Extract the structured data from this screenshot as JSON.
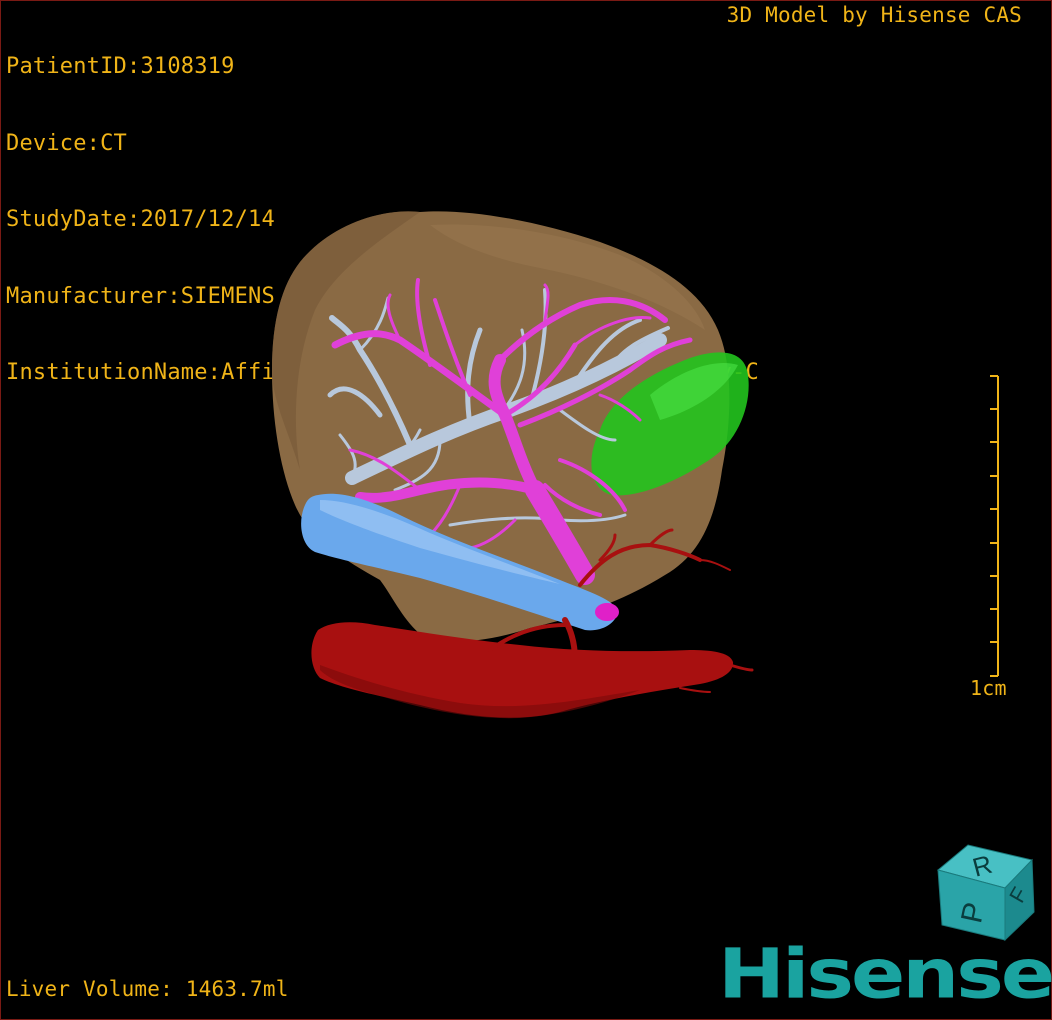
{
  "viewer": {
    "patient_id_line": "PatientID:3108319",
    "device_line": "Device:CT",
    "study_date_line": "StudyDate:2017/12/14",
    "manufacturer_line": "Manufacturer:SIEMENS",
    "institution_line": "InstitutionName:Affiliated Hospital Qingdao University-C",
    "model_credit": "3D Model by Hisense CAS",
    "liver_volume": "Liver Volume: 1463.7ml",
    "scale_label": "1cm",
    "logo_text": "Hisense",
    "orientation_cube": {
      "top_label": "R",
      "side_label": "F",
      "front_label": "P"
    }
  },
  "colors": {
    "overlay_text": "#f0b418",
    "liver_surface": "#8a6a44",
    "portal_vein": "#e040d8",
    "hepatic_vein": "#b8c8dc",
    "ivc": "#6aa8ec",
    "hepatic_artery": "#a81010",
    "lesion": "#22c41e",
    "logo": "#1aa3a0",
    "frame_border": "#7a1a14"
  }
}
